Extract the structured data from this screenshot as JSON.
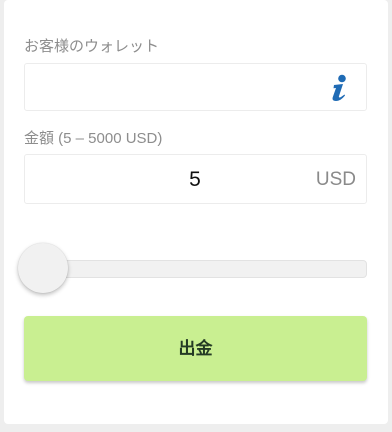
{
  "wallet": {
    "label": "お客様のウォレット",
    "value": "",
    "info_icon": "info-icon"
  },
  "amount": {
    "label": "金額 (5 – 5000 USD)",
    "value": "5",
    "currency": "USD",
    "min": 5,
    "max": 5000
  },
  "slider": {
    "value": 5,
    "min": 5,
    "max": 5000,
    "position_fraction": 0
  },
  "withdraw_button": {
    "label": "出金"
  },
  "colors": {
    "button_green": "#c9ef91",
    "button_text": "#243a24",
    "info_icon_blue": "#1f6bb5",
    "label_gray": "#8d8d8d"
  }
}
